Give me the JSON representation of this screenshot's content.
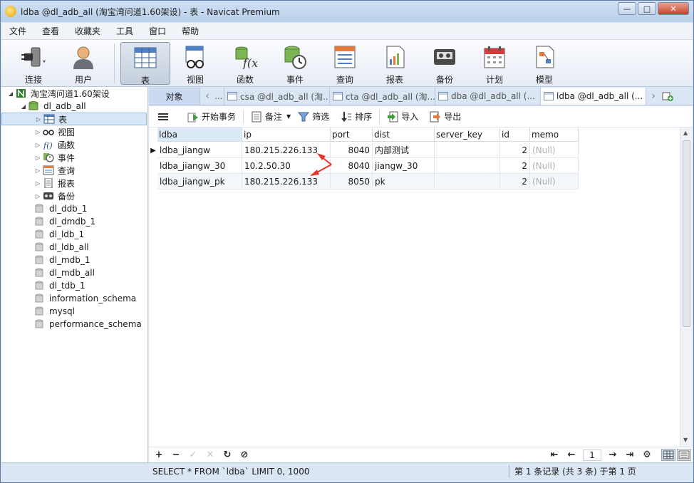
{
  "window": {
    "title": "ldba @dl_adb_all (淘宝湾问道1.60架设) - 表 - Navicat Premium",
    "controls": [
      "minimize",
      "restore",
      "close"
    ]
  },
  "menu": [
    "文件",
    "查看",
    "收藏夹",
    "工具",
    "窗口",
    "帮助"
  ],
  "toolbar": [
    {
      "label": "连接",
      "icon": "connection-plug-icon"
    },
    {
      "label": "用户",
      "icon": "user-icon"
    },
    {
      "label": "表",
      "icon": "table-icon",
      "active": true
    },
    {
      "label": "视图",
      "icon": "view-glasses-icon"
    },
    {
      "label": "函数",
      "icon": "function-icon"
    },
    {
      "label": "事件",
      "icon": "event-clock-icon"
    },
    {
      "label": "查询",
      "icon": "query-icon"
    },
    {
      "label": "报表",
      "icon": "report-icon"
    },
    {
      "label": "备份",
      "icon": "backup-icon"
    },
    {
      "label": "计划",
      "icon": "schedule-calendar-icon"
    },
    {
      "label": "模型",
      "icon": "model-icon"
    }
  ],
  "tree": {
    "connection": "淘宝湾问道1.60架设",
    "database": "dl_adb_all",
    "nodes": [
      {
        "label": "表",
        "icon": "table-icon",
        "selected": true
      },
      {
        "label": "视图",
        "icon": "view-glasses-icon"
      },
      {
        "label": "函数",
        "icon": "function-icon"
      },
      {
        "label": "事件",
        "icon": "event-clock-icon"
      },
      {
        "label": "查询",
        "icon": "query-icon"
      },
      {
        "label": "报表",
        "icon": "report-icon"
      },
      {
        "label": "备份",
        "icon": "backup-icon"
      }
    ],
    "other_databases": [
      "dl_ddb_1",
      "dl_dmdb_1",
      "dl_ldb_1",
      "dl_ldb_all",
      "dl_mdb_1",
      "dl_mdb_all",
      "dl_tdb_1",
      "information_schema",
      "mysql",
      "performance_schema"
    ]
  },
  "tabs": {
    "objects_label": "对象",
    "open": [
      {
        "label": "...",
        "active": false
      },
      {
        "label": "csa @dl_adb_all (淘...",
        "active": false
      },
      {
        "label": "cta @dl_adb_all (淘...",
        "active": false
      },
      {
        "label": "dba @dl_adb_all (...",
        "active": false
      },
      {
        "label": "ldba @dl_adb_all (...",
        "active": true
      }
    ]
  },
  "subtoolbar": {
    "begin_transaction": "开始事务",
    "memo": "备注",
    "filter": "筛选",
    "sort": "排序",
    "import": "导入",
    "export": "导出"
  },
  "grid": {
    "columns": [
      "ldba",
      "ip",
      "port",
      "dist",
      "server_key",
      "id",
      "memo"
    ],
    "rows": [
      [
        "ldba_jiangw",
        "180.215.226.133",
        "8040",
        "内部测试",
        "",
        "2",
        "(Null)"
      ],
      [
        "ldba_jiangw_30",
        "10.2.50.30",
        "8040",
        "jiangw_30",
        "",
        "2",
        "(Null)"
      ],
      [
        "ldba_jiangw_pk",
        "180.215.226.133",
        "8050",
        "pk",
        "",
        "2",
        "(Null)"
      ]
    ],
    "current_row": 0
  },
  "navbar": {
    "page": "1"
  },
  "status": {
    "sql": "SELECT * FROM `ldba` LIMIT 0, 1000",
    "records": "第 1 条记录 (共 3 条) 于第 1 页"
  },
  "colors": {
    "annotation_arrow": "#e8322b",
    "selection": "#d7e6f8",
    "title_bar": "#c3d7ee"
  }
}
